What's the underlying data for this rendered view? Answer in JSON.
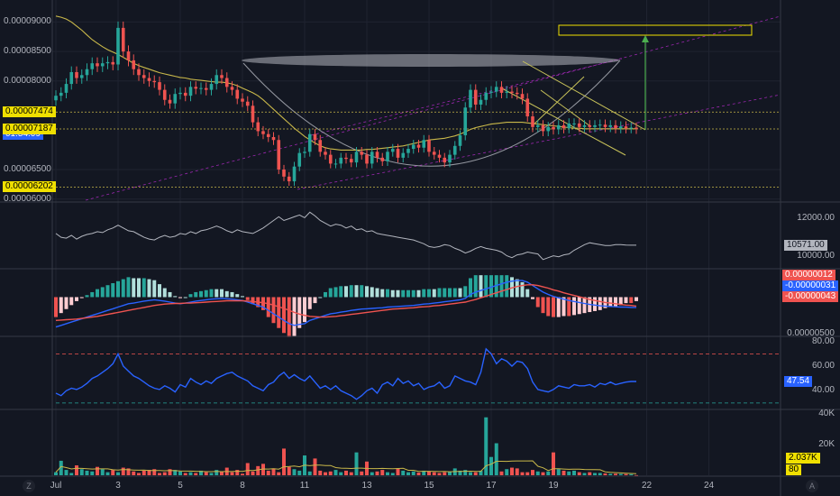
{
  "chart_data": {
    "type": "candlestick",
    "price_axis": {
      "ticks": [
        "0.00009000",
        "0.00008500",
        "0.00008000",
        "0.00006500",
        "0.00006000"
      ],
      "tick_values": [
        9e-05,
        8.5e-05,
        8e-05,
        6.5e-05,
        6e-05
      ],
      "range": [
        5.98e-05,
        9.25e-05
      ],
      "tags": [
        {
          "text": "0.00007474",
          "value": 7.474e-05,
          "bg": "#f0e000",
          "fg": "#000000"
        },
        {
          "text": "0.00007190",
          "value": 7.19e-05,
          "bg": "#2962ff",
          "fg": "#ffffff"
        },
        {
          "text": "01:54:09",
          "value": 7.09e-05,
          "bg": "#2962ff",
          "fg": "#ffffff"
        },
        {
          "text": "0.00007187",
          "value": 7.187e-05,
          "bg": "#f0e000",
          "fg": "#000000"
        },
        {
          "text": "0.00006202",
          "value": 6.202e-05,
          "bg": "#f0e000",
          "fg": "#000000"
        }
      ]
    },
    "x_axis": {
      "labels": [
        "Jul",
        "3",
        "5",
        "8",
        "11",
        "13",
        "15",
        "17",
        "19",
        "22",
        "24"
      ],
      "label_bar_index": [
        0,
        12,
        24,
        36,
        48,
        60,
        72,
        84,
        96,
        114,
        126
      ]
    },
    "candles": {
      "count": 113,
      "close": [
        7.75e-05,
        7.8e-05,
        7.95e-05,
        8.15e-05,
        8.05e-05,
        8.1e-05,
        8.2e-05,
        8.3e-05,
        8.25e-05,
        8.3e-05,
        8.32e-05,
        8.28e-05,
        8.9e-05,
        8.5e-05,
        8.35e-05,
        8.2e-05,
        8.1e-05,
        8.05e-05,
        8e-05,
        7.98e-05,
        7.85e-05,
        7.68e-05,
        7.62e-05,
        7.78e-05,
        7.8e-05,
        7.75e-05,
        7.9e-05,
        7.87e-05,
        7.88e-05,
        7.85e-05,
        7.95e-05,
        8.1e-05,
        8.05e-05,
        7.9e-05,
        7.85e-05,
        7.7e-05,
        7.65e-05,
        7.58e-05,
        7.3e-05,
        7.15e-05,
        7.1e-05,
        7.05e-05,
        7e-05,
        6.5e-05,
        6.38e-05,
        6.3e-05,
        6.55e-05,
        6.78e-05,
        6.8e-05,
        7.1e-05,
        7e-05,
        6.8e-05,
        6.75e-05,
        6.6e-05,
        6.6e-05,
        6.7e-05,
        6.68e-05,
        6.62e-05,
        6.8e-05,
        6.75e-05,
        6.6e-05,
        6.8e-05,
        6.7e-05,
        6.64e-05,
        6.8e-05,
        6.85e-05,
        6.7e-05,
        6.78e-05,
        6.85e-05,
        6.92e-05,
        6.87e-05,
        7e-05,
        6.8e-05,
        6.75e-05,
        6.7e-05,
        6.62e-05,
        6.75e-05,
        6.9e-05,
        7.08e-05,
        7.55e-05,
        7.85e-05,
        7.6e-05,
        7.68e-05,
        7.8e-05,
        7.82e-05,
        7.9e-05,
        7.8e-05,
        7.82e-05,
        7.8e-05,
        7.78e-05,
        7.7e-05,
        7.4e-05,
        7.22e-05,
        7.25e-05,
        7.15e-05,
        7.22e-05,
        7.18e-05,
        7.25e-05,
        7.2e-05,
        7.28e-05,
        7.28e-05,
        7.22e-05,
        7.25e-05,
        7.22e-05,
        7.25e-05,
        7.26e-05,
        7.22e-05,
        7.25e-05,
        7.2e-05,
        7.23e-05,
        7.2e-05,
        7.21e-05,
        7.19e-05
      ],
      "up_color": "#26a69a",
      "down_color": "#ef5350"
    },
    "overlays": {
      "moving_average": [
        9.1e-05,
        9.08e-05,
        9.05e-05,
        9e-05,
        8.93e-05,
        8.86e-05,
        8.78e-05,
        8.7e-05,
        8.64e-05,
        8.58e-05,
        8.53e-05,
        8.49e-05,
        8.45e-05,
        8.4e-05,
        8.35e-05,
        8.3e-05,
        8.26e-05,
        8.23e-05,
        8.2e-05,
        8.17e-05,
        8.14e-05,
        8.12e-05,
        8.1e-05,
        8.08e-05,
        8.06e-05,
        8.05e-05,
        8.03e-05,
        8.02e-05,
        8.01e-05,
        8e-05,
        7.99e-05,
        7.98e-05,
        7.98e-05,
        7.97e-05,
        7.95e-05,
        7.92e-05,
        7.88e-05,
        7.84e-05,
        7.8e-05,
        7.75e-05,
        7.68e-05,
        7.6e-05,
        7.52e-05,
        7.44e-05,
        7.36e-05,
        7.28e-05,
        7.2e-05,
        7.13e-05,
        7.06e-05,
        7e-05,
        6.95e-05,
        6.9e-05,
        6.87e-05,
        6.85e-05,
        6.84e-05,
        6.83e-05,
        6.83e-05,
        6.83e-05,
        6.83e-05,
        6.83e-05,
        6.84e-05,
        6.84e-05,
        6.85e-05,
        6.86e-05,
        6.87e-05,
        6.88e-05,
        6.89e-05,
        6.9e-05,
        6.92e-05,
        6.94e-05,
        6.96e-05,
        6.98e-05,
        7e-05,
        7.01e-05,
        7.02e-05,
        7.03e-05,
        7.05e-05,
        7.07e-05,
        7.1e-05,
        7.14e-05,
        7.18e-05,
        7.21e-05,
        7.23e-05,
        7.25e-05,
        7.27e-05,
        7.28e-05,
        7.29e-05,
        7.3e-05,
        7.3e-05,
        7.3e-05,
        7.3e-05,
        7.29e-05,
        7.28e-05,
        7.27e-05,
        7.26e-05,
        7.25e-05,
        7.24e-05,
        7.23e-05,
        7.22e-05,
        7.21e-05,
        7.2e-05,
        7.2e-05,
        7.19e-05,
        7.19e-05,
        7.19e-05,
        7.19e-05,
        7.19e-05,
        7.19e-05,
        7.19e-05,
        7.19e-05,
        7.19e-05,
        7.19e-05,
        7.19e-05
      ],
      "horizontal_levels": [
        7.474e-05,
        7.187e-05,
        6.202e-05
      ]
    },
    "panes": {
      "obv": {
        "ticks": [
          "12000.00",
          "10000.00"
        ],
        "tick_values": [
          12000,
          10000
        ],
        "range": [
          9400,
          12800
        ],
        "current": "10571.00",
        "line_color": "#b2b5be",
        "values": [
          11200,
          11000,
          10950,
          11100,
          10900,
          11050,
          11150,
          11200,
          11300,
          11250,
          11400,
          11500,
          11650,
          11500,
          11350,
          11300,
          11150,
          11000,
          10900,
          10850,
          11000,
          11100,
          11000,
          11050,
          11200,
          11150,
          11300,
          11200,
          11350,
          11400,
          11500,
          11600,
          11500,
          11350,
          11250,
          11400,
          11300,
          11250,
          11200,
          11350,
          11500,
          11700,
          11900,
          12100,
          11900,
          12000,
          12100,
          12200,
          12050,
          12350,
          12150,
          11900,
          11750,
          11600,
          11700,
          11650,
          11500,
          11600,
          11400,
          11450,
          11300,
          11350,
          11200,
          11150,
          11100,
          11050,
          11000,
          10950,
          10900,
          10850,
          10750,
          10650,
          10500,
          10450,
          10500,
          10600,
          10550,
          10400,
          10300,
          10150,
          10250,
          10400,
          10500,
          10400,
          10350,
          10300,
          10200,
          10000,
          9900,
          10050,
          10100,
          10200,
          10150,
          10100,
          9800,
          9900,
          10000,
          9950,
          10050,
          10100,
          10300,
          10450,
          10600,
          10700,
          10650,
          10600,
          10550,
          10550,
          10600,
          10600,
          10580,
          10570,
          10571
        ]
      },
      "macd": {
        "ticks": [
          "0.00000500"
        ],
        "tags": [
          {
            "text": "0.00000012",
            "bg": "#ef5350",
            "fg": "#ffffff"
          },
          {
            "text": "-0.00000031",
            "bg": "#2962ff",
            "fg": "#ffffff"
          },
          {
            "text": "-0.00000043",
            "bg": "#ef5350",
            "fg": "#ffffff"
          }
        ],
        "range": [
          -1.1e-06,
          8e-07
        ],
        "macd_color": "#2962ff",
        "signal_color": "#ef5350",
        "macd": [
          -9e-07,
          -8.5e-07,
          -8e-07,
          -7.5e-07,
          -7e-07,
          -6.5e-07,
          -6e-07,
          -5.5e-07,
          -5e-07,
          -4.5e-07,
          -4e-07,
          -3.5e-07,
          -3e-07,
          -2.5e-07,
          -2e-07,
          -1.8e-07,
          -1.5e-07,
          -1.2e-07,
          -1e-07,
          -8e-08,
          -1e-07,
          -1.2e-07,
          -1.5e-07,
          -1.8e-07,
          -2e-07,
          -1.8e-07,
          -1.5e-07,
          -1.2e-07,
          -1e-07,
          -8e-08,
          -6e-08,
          -5e-08,
          -4e-08,
          -5e-08,
          -6e-08,
          -8e-08,
          -1e-07,
          -1.5e-07,
          -2e-07,
          -2.5e-07,
          -3e-07,
          -4e-07,
          -5e-07,
          -6e-07,
          -7e-07,
          -8e-07,
          -8.5e-07,
          -8.2e-07,
          -8e-07,
          -7e-07,
          -6.5e-07,
          -6e-07,
          -5.5e-07,
          -5e-07,
          -4.8e-07,
          -4.5e-07,
          -4.3e-07,
          -4e-07,
          -3.8e-07,
          -3.6e-07,
          -3.5e-07,
          -3.4e-07,
          -3.3e-07,
          -3.2e-07,
          -3e-07,
          -2.9e-07,
          -2.8e-07,
          -2.7e-07,
          -2.6e-07,
          -2.5e-07,
          -2.3e-07,
          -2.1e-07,
          -2e-07,
          -1.8e-07,
          -1.6e-07,
          -1.4e-07,
          -1.2e-07,
          -1e-07,
          -8e-08,
          -4e-08,
          8e-08,
          1.5e-07,
          2e-07,
          2.5e-07,
          3e-07,
          3.5e-07,
          4e-07,
          4.5e-07,
          4.8e-07,
          5e-07,
          5e-07,
          4.5e-07,
          3.5e-07,
          2.5e-07,
          1.5e-07,
          8e-08,
          2e-08,
          -2e-08,
          -6e-08,
          -1e-07,
          -1.3e-07,
          -1.6e-07,
          -1.9e-07,
          -2.2e-07,
          -2.4e-07,
          -2.6e-07,
          -2.7e-07,
          -2.8e-07,
          -2.9e-07,
          -3e-07,
          -3e-07,
          -3.1e-07,
          -3.1e-07
        ],
        "signal": [
          -7e-07,
          -6.9e-07,
          -6.8e-07,
          -6.7e-07,
          -6.6e-07,
          -6.4e-07,
          -6.2e-07,
          -6e-07,
          -5.8e-07,
          -5.5e-07,
          -5.2e-07,
          -4.9e-07,
          -4.6e-07,
          -4.3e-07,
          -4e-07,
          -3.7e-07,
          -3.4e-07,
          -3.1e-07,
          -2.8e-07,
          -2.5e-07,
          -2.3e-07,
          -2.1e-07,
          -2e-07,
          -1.9e-07,
          -1.9e-07,
          -1.8e-07,
          -1.8e-07,
          -1.7e-07,
          -1.6e-07,
          -1.5e-07,
          -1.4e-07,
          -1.3e-07,
          -1.2e-07,
          -1.1e-07,
          -1.1e-07,
          -1.1e-07,
          -1.1e-07,
          -1.2e-07,
          -1.3e-07,
          -1.5e-07,
          -1.7e-07,
          -2e-07,
          -2.4e-07,
          -2.9e-07,
          -3.4e-07,
          -4e-07,
          -4.6e-07,
          -5.1e-07,
          -5.5e-07,
          -5.8e-07,
          -5.9e-07,
          -6e-07,
          -6e-07,
          -5.9e-07,
          -5.8e-07,
          -5.6e-07,
          -5.4e-07,
          -5.2e-07,
          -5e-07,
          -4.8e-07,
          -4.6e-07,
          -4.4e-07,
          -4.2e-07,
          -4e-07,
          -3.8e-07,
          -3.6e-07,
          -3.5e-07,
          -3.4e-07,
          -3.3e-07,
          -3.2e-07,
          -3e-07,
          -2.9e-07,
          -2.8e-07,
          -2.6e-07,
          -2.5e-07,
          -2.3e-07,
          -2.1e-07,
          -1.9e-07,
          -1.7e-07,
          -1.5e-07,
          -1.1e-07,
          -7e-08,
          -2e-08,
          3e-08,
          8e-08,
          1.3e-07,
          1.8e-07,
          2.3e-07,
          2.8e-07,
          3.2e-07,
          3.5e-07,
          3.7e-07,
          3.7e-07,
          3.5e-07,
          3.1e-07,
          2.7e-07,
          2.2e-07,
          1.8e-07,
          1.3e-07,
          9e-08,
          5e-08,
          1e-08,
          -3e-08,
          -7e-08,
          -1e-07,
          -1.3e-07,
          -1.6e-07,
          -1.8e-07,
          -2e-07,
          -2.2e-07,
          -2.4e-07,
          -2.5e-07,
          -2.7e-07
        ]
      },
      "rsi": {
        "ticks": [
          "80.00",
          "60.00",
          "40.00"
        ],
        "tick_values": [
          80,
          60,
          40
        ],
        "range": [
          27,
          82
        ],
        "current": "47.54",
        "upper_level": 70,
        "lower_level": 30,
        "line_color": "#2962ff",
        "values": [
          38,
          36,
          40,
          42,
          41,
          43,
          46,
          50,
          52,
          55,
          58,
          62,
          70,
          60,
          56,
          52,
          50,
          47,
          44,
          42,
          41,
          44,
          42,
          39,
          45,
          43,
          50,
          47,
          45,
          48,
          46,
          50,
          52,
          54,
          55,
          52,
          50,
          48,
          44,
          42,
          40,
          45,
          47,
          52,
          55,
          50,
          53,
          50,
          48,
          52,
          47,
          42,
          44,
          41,
          44,
          40,
          38,
          36,
          33,
          36,
          40,
          42,
          38,
          45,
          47,
          44,
          50,
          46,
          48,
          44,
          46,
          41,
          43,
          44,
          47,
          42,
          44,
          52,
          50,
          48,
          47,
          45,
          55,
          74,
          70,
          62,
          66,
          64,
          60,
          64,
          63,
          58,
          47,
          41,
          40,
          39,
          41,
          44,
          43,
          42,
          45,
          44,
          44,
          45,
          43,
          46,
          45,
          47,
          45,
          46,
          47,
          47.54,
          47.54
        ]
      },
      "volume": {
        "ticks": [
          "40K",
          "20K"
        ],
        "tick_values": [
          40000,
          20000
        ],
        "range": [
          0,
          42000
        ],
        "tags": [
          {
            "text": "2.037K",
            "bg": "#f0e000",
            "fg": "#000000"
          },
          {
            "text": "80",
            "bg": "#f0e000",
            "fg": "#000000"
          }
        ],
        "values": [
          2000,
          9500,
          3500,
          1500,
          6500,
          4000,
          3000,
          2500,
          5500,
          4000,
          2000,
          3500,
          2000,
          5000,
          4500,
          2500,
          1500,
          3000,
          3500,
          4000,
          1500,
          2000,
          4000,
          3500,
          2500,
          1500,
          2000,
          1500,
          3000,
          2000,
          1500,
          3500,
          2500,
          5000,
          2000,
          3500,
          1000,
          8000,
          2500,
          6000,
          7500,
          3000,
          4500,
          2000,
          17500,
          5500,
          4000,
          3000,
          13000,
          2500,
          11000,
          3000,
          2000,
          2500,
          3500,
          2000,
          3000,
          2000,
          15000,
          2500,
          9000,
          2000,
          2500,
          3500,
          2000,
          1500,
          4500,
          3000,
          2000,
          2500,
          1800,
          3000,
          2500,
          2000,
          1500,
          2000,
          2500,
          4500,
          3000,
          3500,
          2000,
          2000,
          3000,
          38000,
          12000,
          21000,
          2500,
          4000,
          5000,
          4500,
          2000,
          2000,
          3500,
          2500,
          2000,
          2500,
          15000,
          4000,
          3000,
          2500,
          3000,
          2000,
          1500,
          2000,
          1500,
          1500,
          1200,
          1000,
          1000,
          900,
          800,
          700,
          80
        ]
      }
    }
  }
}
